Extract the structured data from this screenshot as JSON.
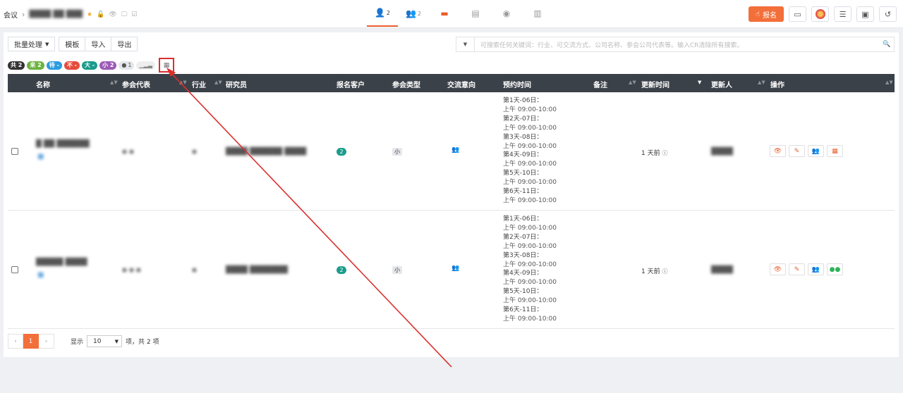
{
  "breadcrumb": {
    "root": "会议",
    "sep": "›",
    "meeting_name": "████ ██ ███"
  },
  "header_tabs": [
    {
      "count": "2",
      "icon": "user-icon",
      "glyph": "👤",
      "active": true
    },
    {
      "count": "2",
      "icon": "users-icon",
      "glyph": "👥",
      "active": false
    },
    {
      "count": "",
      "icon": "ticket-icon",
      "glyph": "▭",
      "active": false
    },
    {
      "count": "",
      "icon": "calculator-icon",
      "glyph": "▤",
      "active": false
    },
    {
      "count": "",
      "icon": "person-icon",
      "glyph": "◉",
      "active": false
    },
    {
      "count": "",
      "icon": "bar-chart-icon",
      "glyph": "▥",
      "active": false
    }
  ],
  "header": {
    "signup_label": "报名"
  },
  "toolbar": {
    "batch_label": "批量处理",
    "template_label": "模板",
    "import_label": "导入",
    "export_label": "导出"
  },
  "search": {
    "placeholder": "可搜索任何关键词：行业、可交流方式、公司名称、参会公司代表等。输入CR清除所有搜索。"
  },
  "badges": [
    {
      "label": "共 2",
      "color": "#333333"
    },
    {
      "label": "来 2",
      "color": "#6cb33e"
    },
    {
      "label": "待 -",
      "color": "#2b9be0"
    },
    {
      "label": "不 -",
      "color": "#e64b3c"
    },
    {
      "label": "大 -",
      "color": "#1a9c8c"
    },
    {
      "label": "小 2",
      "color": "#9b59b6"
    }
  ],
  "wechat_badge": "1",
  "table": {
    "headers": {
      "name": "名称",
      "rep": "参会代表",
      "industry": "行业",
      "researcher": "研究员",
      "clients": "报名客户",
      "type": "参会类型",
      "intent": "交流意向",
      "time": "预约时间",
      "note": "备注",
      "updated": "更新时间",
      "updater": "更新人",
      "ops": "操作"
    },
    "rows": [
      {
        "name": "█ ██ ██████",
        "tag": "■",
        "rep": "▪ ▪",
        "industry": "▪",
        "researcher": "████ ██████ ████",
        "clients": "2",
        "type": "小",
        "intent": "👥",
        "schedule": [
          {
            "day": "第1天-06日：",
            "time": "上午 09:00-10:00"
          },
          {
            "day": "第2天-07日：",
            "time": "上午 09:00-10:00"
          },
          {
            "day": "第3天-08日：",
            "time": "上午 09:00-10:00"
          },
          {
            "day": "第4天-09日：",
            "time": "上午 09:00-10:00"
          },
          {
            "day": "第5天-10日：",
            "time": "上午 09:00-10:00"
          },
          {
            "day": "第6天-11日：",
            "time": "上午 09:00-10:00"
          }
        ],
        "updated": "1 天前",
        "updater": "████"
      },
      {
        "name": "█████ ████",
        "tag": "■",
        "rep": "▪ ▪ ▪",
        "industry": "▪",
        "researcher": "████ ███████",
        "clients": "2",
        "type": "小",
        "intent": "👥",
        "schedule": [
          {
            "day": "第1天-06日：",
            "time": "上午 09:00-10:00"
          },
          {
            "day": "第2天-07日：",
            "time": "上午 09:00-10:00"
          },
          {
            "day": "第3天-08日：",
            "time": "上午 09:00-10:00"
          },
          {
            "day": "第4天-09日：",
            "time": "上午 09:00-10:00"
          },
          {
            "day": "第5天-10日：",
            "time": "上午 09:00-10:00"
          },
          {
            "day": "第6天-11日：",
            "time": "上午 09:00-10:00"
          }
        ],
        "updated": "1 天前",
        "updater": "████"
      }
    ]
  },
  "pagination": {
    "prev": "‹",
    "current": "1",
    "next": "›",
    "show_label": "显示",
    "page_size": "10",
    "summary": "项，共 2 项"
  },
  "colors": {
    "accent": "#f36f3a",
    "header_bg": "#3b4148",
    "annotation": "#d9302e",
    "teal": "#1a9c8c"
  }
}
